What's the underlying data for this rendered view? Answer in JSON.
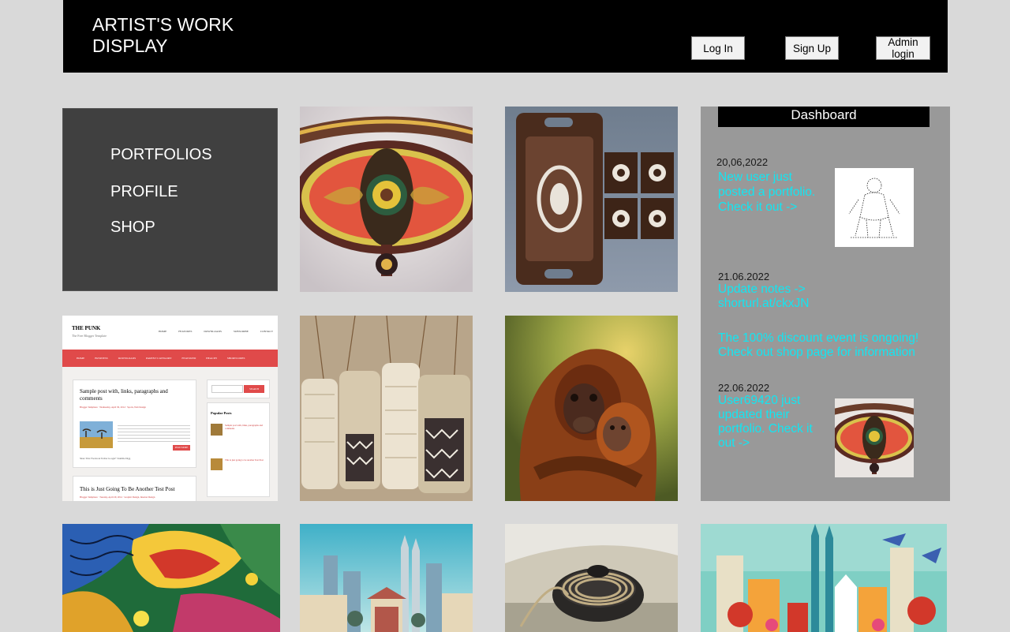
{
  "header": {
    "title": "ARTIST'S WORK DISPLAY",
    "login_label": "Log In",
    "signup_label": "Sign Up",
    "admin_label": "Admin login"
  },
  "sidebar": {
    "items": [
      {
        "label": "PORTFOLIOS"
      },
      {
        "label": "PROFILE"
      },
      {
        "label": "SHOP"
      }
    ]
  },
  "blog_preview": {
    "site_name": "THE PUNK",
    "tagline": "The Free Blogger Template",
    "nav": [
      "HOME",
      "FEATURES",
      "DOWNLOADS",
      "SUBSCRIBE",
      "CONTACT"
    ],
    "menu": [
      "HOME",
      "BUSINESS",
      "DOWNLOADS",
      "PARENT CATEGORY",
      "FEATURED",
      "HEALTH",
      "SHORTCODES"
    ],
    "search_button": "SEARCH",
    "post1_title": "Sample post with, links, paragraphs and comments",
    "post1_meta": "Blogger Templates · Wednesday, April 30, 2014 · Sports, Web Design",
    "post1_more": "READ MORE",
    "share": "Share This: Facebook Twitter Google+ Stumble Digg",
    "post2_title": "This is Just Going To Be Another Test Post",
    "post2_meta": "Blogger Templates · Tuesday, April 29, 2014 · Graphic Design, Internet Design",
    "popular_heading": "Popular Posts",
    "popular1": "Sample post with, links, paragraphs and comments",
    "popular2": "This is just going to be another Test Post"
  },
  "dashboard": {
    "title": "Dashboard",
    "entries": [
      {
        "date": "20,06,2022",
        "text": "New user just posted a portfolio. Check it out ->"
      },
      {
        "date": "21.06.2022",
        "text": "Update notes -> shorturl.at/ckxJN"
      },
      {
        "date": "",
        "text": "The 100% discount event is ongoing! Check out shop page for information"
      },
      {
        "date": "22.06.2022",
        "text": "User69420 just updated their portfolio. Check it out ->"
      }
    ]
  },
  "gallery": [
    {
      "name": "wau-kite-artwork"
    },
    {
      "name": "carved-wooden-tray-artwork"
    },
    {
      "name": "woven-baskets-artwork"
    },
    {
      "name": "orangutan-photo-artwork"
    },
    {
      "name": "colorful-abstract-painting"
    },
    {
      "name": "city-illustration-artwork"
    },
    {
      "name": "spinning-top-artwork"
    },
    {
      "name": "kuala-lumpur-illustration-artwork"
    }
  ],
  "colors": {
    "page_bg": "#d9d9d9",
    "header_bg": "#000000",
    "sidebar_bg": "#404040",
    "dashboard_bg": "#999999",
    "notice_text": "#12e6f2"
  }
}
